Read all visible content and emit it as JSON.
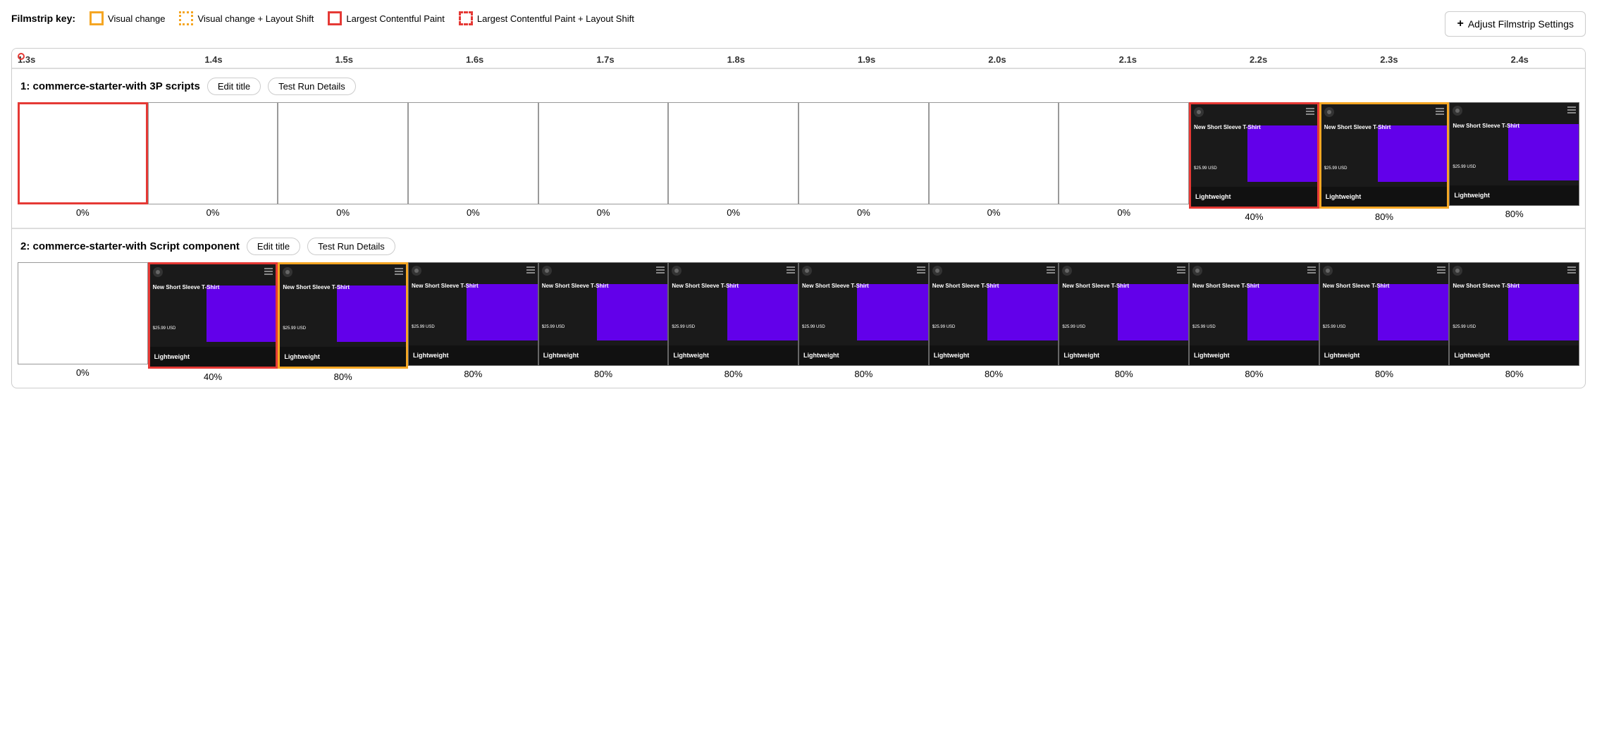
{
  "filmstrip_key": {
    "label": "Filmstrip key:",
    "items": [
      {
        "id": "visual-change",
        "label": "Visual change",
        "border_style": "solid",
        "border_color": "#f5a623"
      },
      {
        "id": "visual-change-layout",
        "label": "Visual change + Layout Shift",
        "border_style": "dotted",
        "border_color": "#f5a623"
      },
      {
        "id": "lcp",
        "label": "Largest Contentful Paint",
        "border_style": "solid",
        "border_color": "#e53935"
      },
      {
        "id": "lcp-layout",
        "label": "Largest Contentful Paint + Layout Shift",
        "border_style": "dashed",
        "border_color": "#e53935"
      }
    ],
    "adjust_button": "Adjust Filmstrip Settings"
  },
  "timeline": {
    "markers": [
      "1.3s",
      "1.4s",
      "1.5s",
      "1.6s",
      "1.7s",
      "1.8s",
      "1.9s",
      "2.0s",
      "2.1s",
      "2.2s",
      "2.3s",
      "2.4s"
    ]
  },
  "strips": [
    {
      "id": "strip-1",
      "title": "1: commerce-starter-with 3P scripts",
      "edit_title_label": "Edit title",
      "test_run_details_label": "Test Run Details",
      "frames": [
        {
          "id": "f1-1",
          "type": "empty",
          "border": "lcp",
          "percent": "0%"
        },
        {
          "id": "f1-2",
          "type": "empty",
          "border": "normal",
          "percent": "0%"
        },
        {
          "id": "f1-3",
          "type": "empty",
          "border": "normal",
          "percent": "0%"
        },
        {
          "id": "f1-4",
          "type": "empty",
          "border": "normal",
          "percent": "0%"
        },
        {
          "id": "f1-5",
          "type": "empty",
          "border": "normal",
          "percent": "0%"
        },
        {
          "id": "f1-6",
          "type": "empty",
          "border": "normal",
          "percent": "0%"
        },
        {
          "id": "f1-7",
          "type": "empty",
          "border": "normal",
          "percent": "0%"
        },
        {
          "id": "f1-8",
          "type": "empty",
          "border": "normal",
          "percent": "0%"
        },
        {
          "id": "f1-9",
          "type": "empty",
          "border": "normal",
          "percent": "0%"
        },
        {
          "id": "f1-10",
          "type": "screenshot",
          "border": "lcp",
          "percent": "40%",
          "text": "New Short Sleeve T-Shirt",
          "price": "$25.99 USD",
          "bottom_label": "Lightweight"
        },
        {
          "id": "f1-11",
          "type": "screenshot",
          "border": "visual",
          "percent": "80%",
          "text": "New Short Sleeve T-Shirt",
          "price": "$25.99 USD",
          "bottom_label": "Lightweight"
        },
        {
          "id": "f1-12",
          "type": "screenshot",
          "border": "normal",
          "percent": "80%",
          "text": "New Short Sleeve T-Shirt",
          "price": "$25.99 USD",
          "bottom_label": "Lightweight"
        }
      ]
    },
    {
      "id": "strip-2",
      "title": "2: commerce-starter-with Script component",
      "edit_title_label": "Edit title",
      "test_run_details_label": "Test Run Details",
      "frames": [
        {
          "id": "f2-1",
          "type": "empty",
          "border": "normal",
          "percent": "0%"
        },
        {
          "id": "f2-2",
          "type": "screenshot",
          "border": "lcp",
          "percent": "40%",
          "text": "New Short Sleeve T-Shirt",
          "price": "$25.99 USD",
          "bottom_label": "Lightweight"
        },
        {
          "id": "f2-3",
          "type": "screenshot",
          "border": "visual",
          "percent": "80%",
          "text": "New Short Sleeve T-Shirt",
          "price": "$25.99 USD",
          "bottom_label": "Lightweight"
        },
        {
          "id": "f2-4",
          "type": "screenshot",
          "border": "normal",
          "percent": "80%",
          "text": "New Short Sleeve T-Shirt",
          "price": "$25.99 USD",
          "bottom_label": "Lightweight"
        },
        {
          "id": "f2-5",
          "type": "screenshot",
          "border": "normal",
          "percent": "80%",
          "text": "New Short Sleeve T-Shirt",
          "price": "$25.99 USD",
          "bottom_label": "Lightweight"
        },
        {
          "id": "f2-6",
          "type": "screenshot",
          "border": "normal",
          "percent": "80%",
          "text": "New Short Sleeve T-Shirt",
          "price": "$25.99 USD",
          "bottom_label": "Lightweight"
        },
        {
          "id": "f2-7",
          "type": "screenshot",
          "border": "normal",
          "percent": "80%",
          "text": "New Short Sleeve T-Shirt",
          "price": "$25.99 USD",
          "bottom_label": "Lightweight"
        },
        {
          "id": "f2-8",
          "type": "screenshot",
          "border": "normal",
          "percent": "80%",
          "text": "New Short Sleeve T-Shirt",
          "price": "$25.99 USD",
          "bottom_label": "Lightweight"
        },
        {
          "id": "f2-9",
          "type": "screenshot",
          "border": "normal",
          "percent": "80%",
          "text": "New Short Sleeve T-Shirt",
          "price": "$25.99 USD",
          "bottom_label": "Lightweight"
        },
        {
          "id": "f2-10",
          "type": "screenshot",
          "border": "normal",
          "percent": "80%",
          "text": "New Short Sleeve T-Shirt",
          "price": "$25.99 USD",
          "bottom_label": "Lightweight"
        },
        {
          "id": "f2-11",
          "type": "screenshot",
          "border": "normal",
          "percent": "80%",
          "text": "New Short Sleeve T-Shirt",
          "price": "$25.99 USD",
          "bottom_label": "Lightweight"
        },
        {
          "id": "f2-12",
          "type": "screenshot",
          "border": "normal",
          "percent": "80%",
          "text": "New Short Sleeve T-Shirt",
          "price": "$25.99 USD",
          "bottom_label": "Lightweight"
        }
      ]
    }
  ]
}
